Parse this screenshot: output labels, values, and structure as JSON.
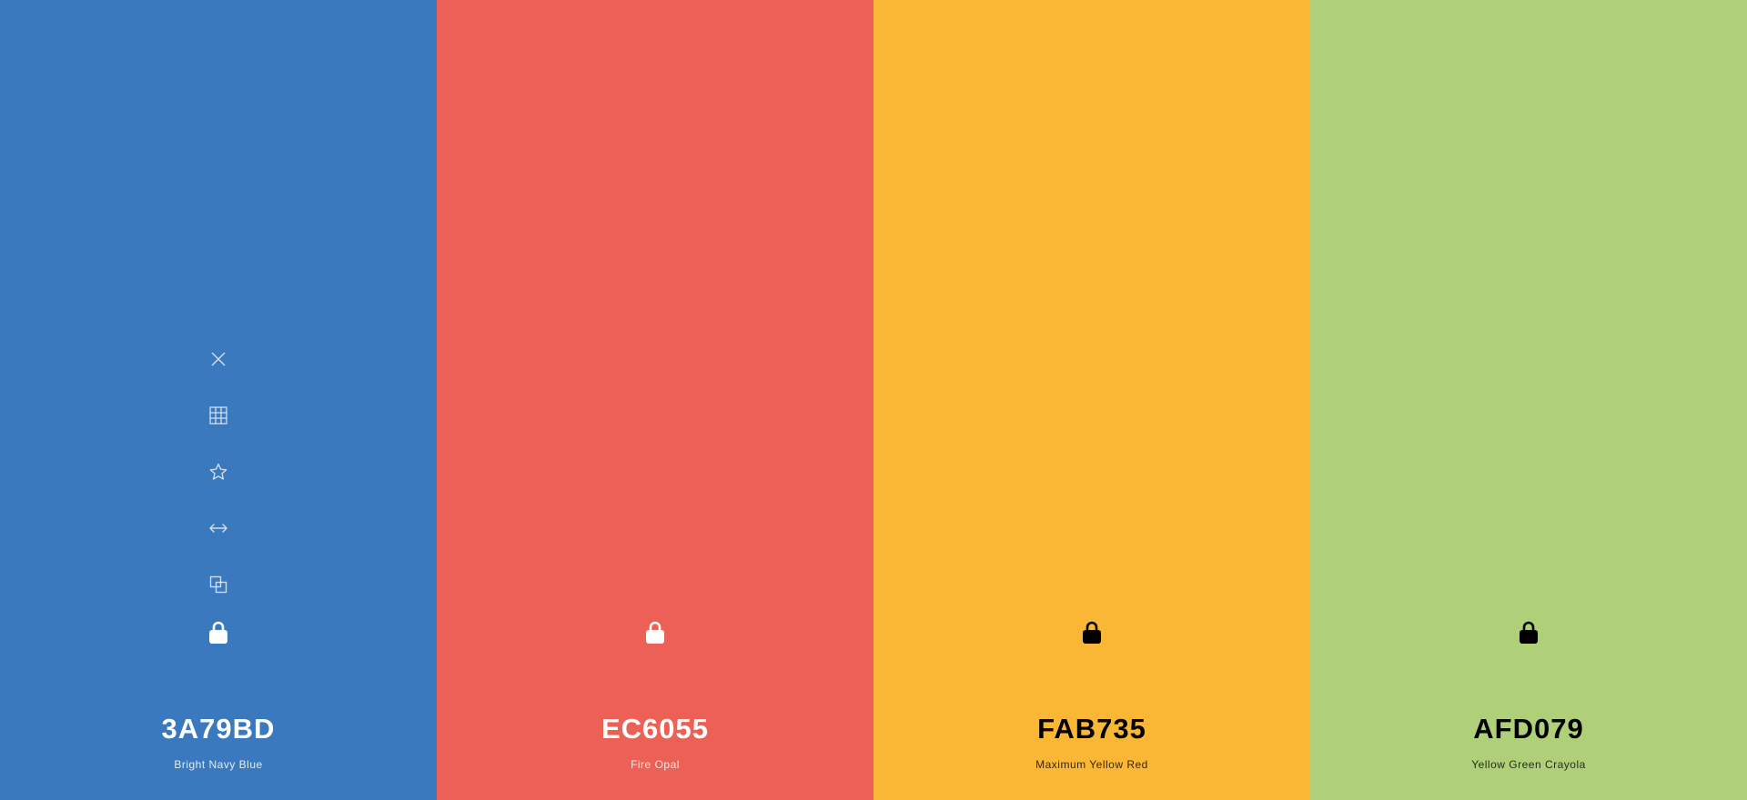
{
  "swatches": [
    {
      "hex": "3A79BD",
      "name": "Bright Navy Blue",
      "color": "#3A79BD",
      "text_tone": "light"
    },
    {
      "hex": "EC6055",
      "name": "Fire Opal",
      "color": "#EC6055",
      "text_tone": "light"
    },
    {
      "hex": "FAB735",
      "name": "Maximum Yellow Red",
      "color": "#FAB735",
      "text_tone": "dark"
    },
    {
      "hex": "AFD079",
      "name": "Yellow Green Crayola",
      "color": "#AFD079",
      "text_tone": "dark"
    }
  ],
  "toolbar": {
    "icons": [
      "close-icon",
      "grid-icon",
      "star-icon",
      "arrows-horizontal-icon",
      "copy-icon"
    ],
    "shown_on_swatch": "Bright Navy Blue"
  },
  "lock_icon": "lock-icon"
}
